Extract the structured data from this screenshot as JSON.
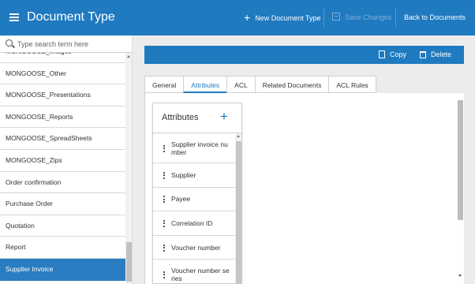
{
  "header": {
    "title": "Document Type",
    "new_label": "New Document Type",
    "save_label": "Save Changes",
    "back_label": "Back to Documents"
  },
  "sidebar": {
    "search_placeholder": "Type search term here",
    "items": [
      {
        "label": "MONGOOSE_Images"
      },
      {
        "label": "MONGOOSE_Other"
      },
      {
        "label": "MONGOOSE_Presentations"
      },
      {
        "label": "MONGOOSE_Reports"
      },
      {
        "label": "MONGOOSE_SpreadSheets"
      },
      {
        "label": "MONGOOSE_Zips"
      },
      {
        "label": "Order confirmation"
      },
      {
        "label": "Purchase Order"
      },
      {
        "label": "Quotation"
      },
      {
        "label": "Report"
      },
      {
        "label": "Supplier Invoice",
        "active": true
      }
    ]
  },
  "toolbar": {
    "copy_label": "Copy",
    "delete_label": "Delete"
  },
  "tabs": [
    {
      "label": "General"
    },
    {
      "label": "Attributes",
      "active": true
    },
    {
      "label": "ACL"
    },
    {
      "label": "Related Documents"
    },
    {
      "label": "ACL Rules"
    }
  ],
  "attributes": {
    "title": "Attributes",
    "items": [
      {
        "label": "Supplier invoice nu mber"
      },
      {
        "label": "Supplier"
      },
      {
        "label": "Payee"
      },
      {
        "label": "Correlation ID"
      },
      {
        "label": "Voucher number"
      },
      {
        "label": "Voucher number se ries"
      }
    ]
  },
  "colors": {
    "accent": "#1f7ac0",
    "active_item": "#2a7dc0"
  }
}
